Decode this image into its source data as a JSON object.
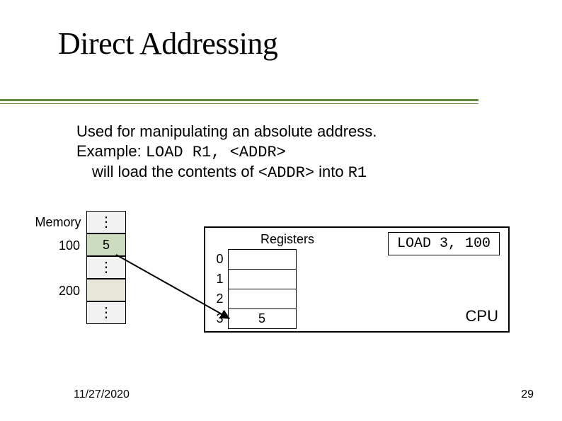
{
  "title": "Direct Addressing",
  "body": {
    "line1": "Used for manipulating an absolute address.",
    "line2_prefix": "Example: ",
    "line2_code": "LOAD R1, <ADDR>",
    "line3_prefix": "will load the contents of ",
    "line3_code1": "<ADDR>",
    "line3_mid": " into ",
    "line3_code2": "R1"
  },
  "memory": {
    "header": "Memory",
    "rows": [
      {
        "addr": "",
        "cell": "⋮",
        "cls": "vdots"
      },
      {
        "addr": "100",
        "cell": "5",
        "cls": "val5"
      },
      {
        "addr": "",
        "cell": "⋮",
        "cls": "vdots"
      },
      {
        "addr": "200",
        "cell": "",
        "cls": "addr200"
      },
      {
        "addr": "",
        "cell": "⋮",
        "cls": "vdots"
      }
    ]
  },
  "cpu": {
    "reg_title": "Registers",
    "instr": "LOAD 3, 100",
    "label": "CPU",
    "reg_indices": [
      "0",
      "1",
      "2",
      "3"
    ],
    "reg_values": [
      "",
      "",
      "",
      "5"
    ]
  },
  "footer": {
    "date": "11/27/2020",
    "page": "29"
  }
}
